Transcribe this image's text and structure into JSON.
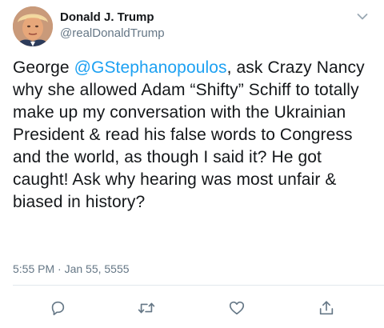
{
  "tweet": {
    "author": {
      "display_name": "Donald J. Trump",
      "handle": "@realDonaldTrump",
      "avatar_icon": "profile-avatar"
    },
    "menu_icon": "chevron-down-icon",
    "text_segments": {
      "prefix": "George ",
      "mention": "@GStephanopoulos",
      "rest": ", ask Crazy Nancy why she allowed Adam “Shifty” Schiff to totally make up my conversation with the Ukrainian President & read his false words to Congress and the world, as though I said it? He got caught! Ask why hearing was most unfair & biased in history?"
    },
    "timestamp": "5:55 PM · Jan 55, 5555",
    "actions": [
      {
        "name": "reply",
        "icon": "reply-icon"
      },
      {
        "name": "retweet",
        "icon": "retweet-icon"
      },
      {
        "name": "like",
        "icon": "heart-icon"
      },
      {
        "name": "share",
        "icon": "share-icon"
      }
    ],
    "colors": {
      "accent": "#1da1f2",
      "text": "#14171a",
      "secondary": "#657786",
      "divider": "#e1e8ed"
    }
  }
}
